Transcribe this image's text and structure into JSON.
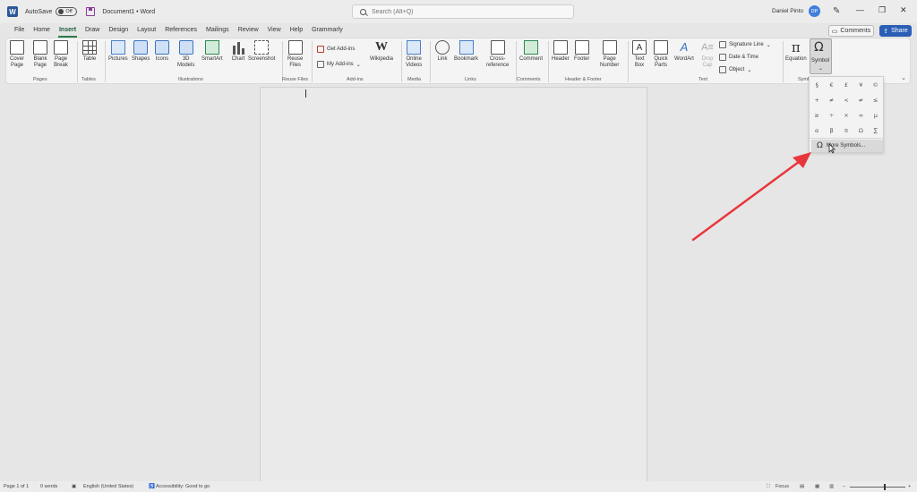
{
  "titlebar": {
    "autosave_label": "AutoSave",
    "autosave_state": "Off",
    "document_title": "Document1 • Word",
    "search_placeholder": "Search (Alt+Q)",
    "user_name": "Daniel Pinto",
    "user_initials": "DP",
    "minimize": "—",
    "restore": "❐",
    "close": "✕"
  },
  "tabs": [
    "File",
    "Home",
    "Insert",
    "Draw",
    "Design",
    "Layout",
    "References",
    "Mailings",
    "Review",
    "View",
    "Help",
    "Grammarly"
  ],
  "active_tab": "Insert",
  "actions": {
    "comments": "Comments",
    "share": "Share"
  },
  "ribbon": {
    "pages": {
      "cover_page": "Cover\nPage",
      "blank_page": "Blank\nPage",
      "page_break": "Page\nBreak",
      "label": "Pages"
    },
    "tables": {
      "table": "Table",
      "label": "Tables"
    },
    "illustrations": {
      "pictures": "Pictures",
      "shapes": "Shapes",
      "icons": "Icons",
      "models": "3D\nModels",
      "smartart": "SmartArt",
      "chart": "Chart",
      "screenshot": "Screenshot",
      "label": "Illustrations"
    },
    "reuse": {
      "reuse_files": "Reuse\nFiles",
      "label": "Reuse Files"
    },
    "addins": {
      "get_addins": "Get Add-ins",
      "my_addins": "My Add-ins",
      "wikipedia": "Wikipedia",
      "label": "Add-ins"
    },
    "media": {
      "online_videos": "Online\nVideos",
      "label": "Media"
    },
    "links": {
      "link": "Link",
      "bookmark": "Bookmark",
      "cross_reference": "Cross-\nreference",
      "label": "Links"
    },
    "comments": {
      "comment": "Comment",
      "label": "Comments"
    },
    "header_footer": {
      "header": "Header",
      "footer": "Footer",
      "page_number": "Page\nNumber",
      "label": "Header & Footer"
    },
    "text": {
      "text_box": "Text\nBox",
      "quick_parts": "Quick\nParts",
      "wordart": "WordArt",
      "drop_cap": "Drop\nCap",
      "signature_line": "Signature Line",
      "date_time": "Date & Time",
      "object": "Object",
      "label": "Text"
    },
    "symbols": {
      "equation": "Equation",
      "symbol": "Symbol",
      "label": "Symb"
    }
  },
  "symbol_dropdown": {
    "symbols": [
      "§",
      "€",
      "£",
      "¥",
      "©",
      "+",
      "≠",
      "<",
      "≠",
      "≤",
      "≥",
      "÷",
      "×",
      "∞",
      "µ",
      "α",
      "β",
      "π",
      "Ω",
      "∑"
    ],
    "more_symbols": "More Symbols..."
  },
  "statusbar": {
    "page": "Page 1 of 1",
    "words": "0 words",
    "language": "English (United States)",
    "accessibility": "Accessibility: Good to go",
    "focus": "Focus"
  },
  "colors": {
    "accent_arrow": "#e8373c",
    "share_bg": "#2b5eb5",
    "active_tab": "#1b5e3b"
  }
}
